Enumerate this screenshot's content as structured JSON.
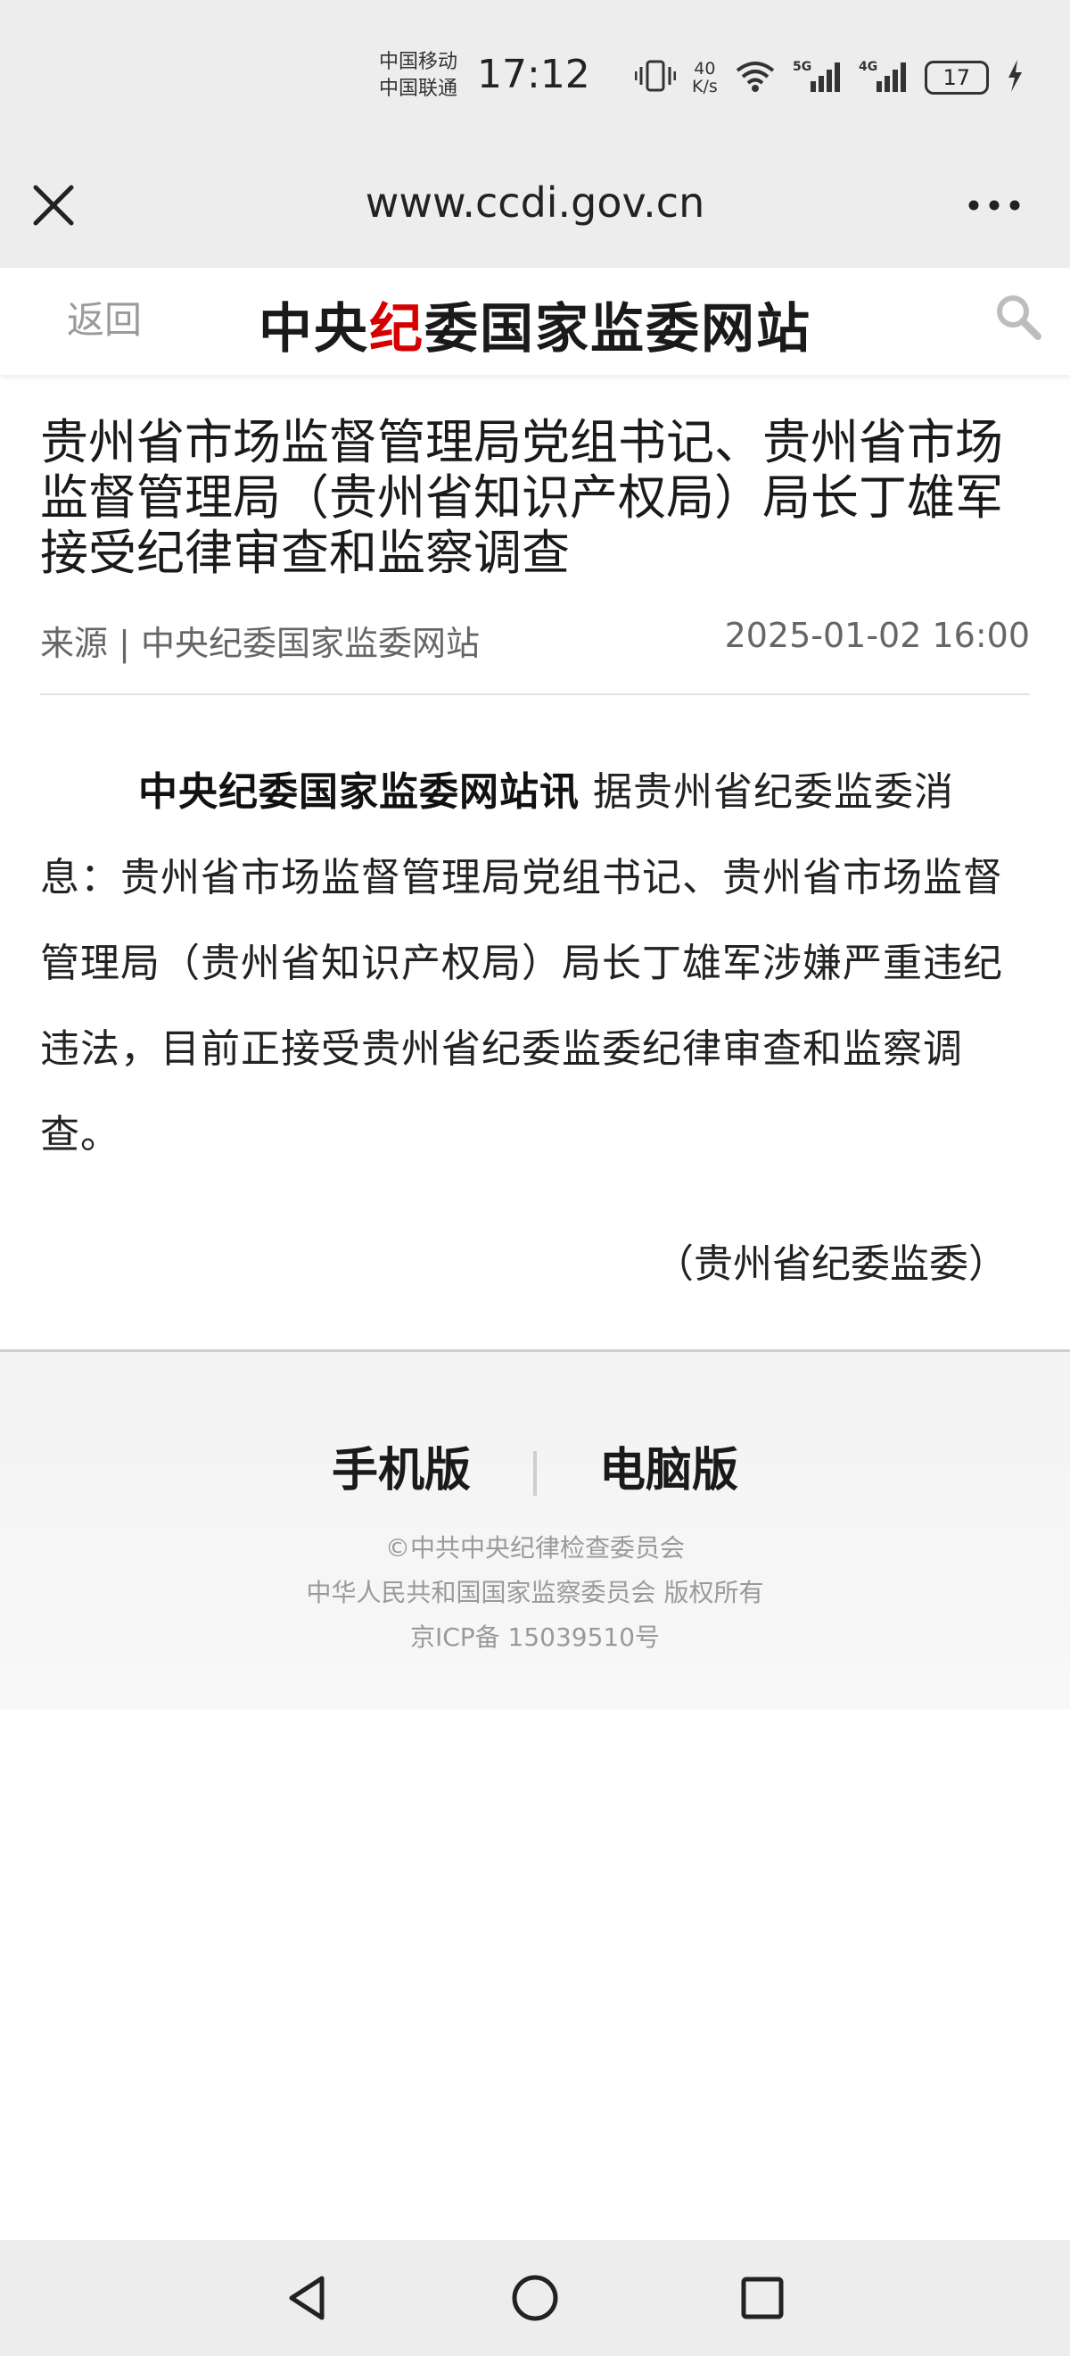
{
  "status_bar": {
    "carrier_1": "中国移动",
    "carrier_2": "中国联通",
    "time": "17:12",
    "net_speed_value": "40",
    "net_speed_unit": "K/s",
    "battery": "17",
    "icons": [
      "vibrate-icon",
      "wifi-icon",
      "signal-5g-icon",
      "signal-4g-icon",
      "battery-icon",
      "charging-icon"
    ]
  },
  "browser": {
    "url": "www.ccdi.gov.cn",
    "icons": [
      "close-icon",
      "more-icon"
    ]
  },
  "site_header": {
    "back_label": "返回",
    "logo_part1": "中央",
    "logo_part2": "纪",
    "logo_part3": "委国家监委网站",
    "logo_accent_color": "#d40000",
    "search_icon": "search-icon"
  },
  "article": {
    "title": "贵州省市场监督管理局党组书记、贵州省市场监督管理局（贵州省知识产权局）局长丁雄军接受纪律审查和监察调查",
    "source": "来源 | 中央纪委国家监委网站",
    "date": "2025-01-02 16:00",
    "body_lead": "中央纪委国家监委网站讯",
    "body_text": " 据贵州省纪委监委消息：贵州省市场监督管理局党组书记、贵州省市场监督管理局（贵州省知识产权局）局长丁雄军涉嫌严重违纪违法，目前正接受贵州省纪委监委纪律审查和监察调查。",
    "sign": "（贵州省纪委监委）"
  },
  "footer": {
    "mobile_label": "手机版",
    "desktop_label": "电脑版",
    "copyright_1": "©中共中央纪律检查委员会",
    "copyright_2": "中华人民共和国国家监察委员会 版权所有",
    "copyright_3": "京ICP备 15039510号"
  },
  "nav_bar": {
    "icons": [
      "back-triangle-icon",
      "home-circle-icon",
      "recents-square-icon"
    ]
  }
}
